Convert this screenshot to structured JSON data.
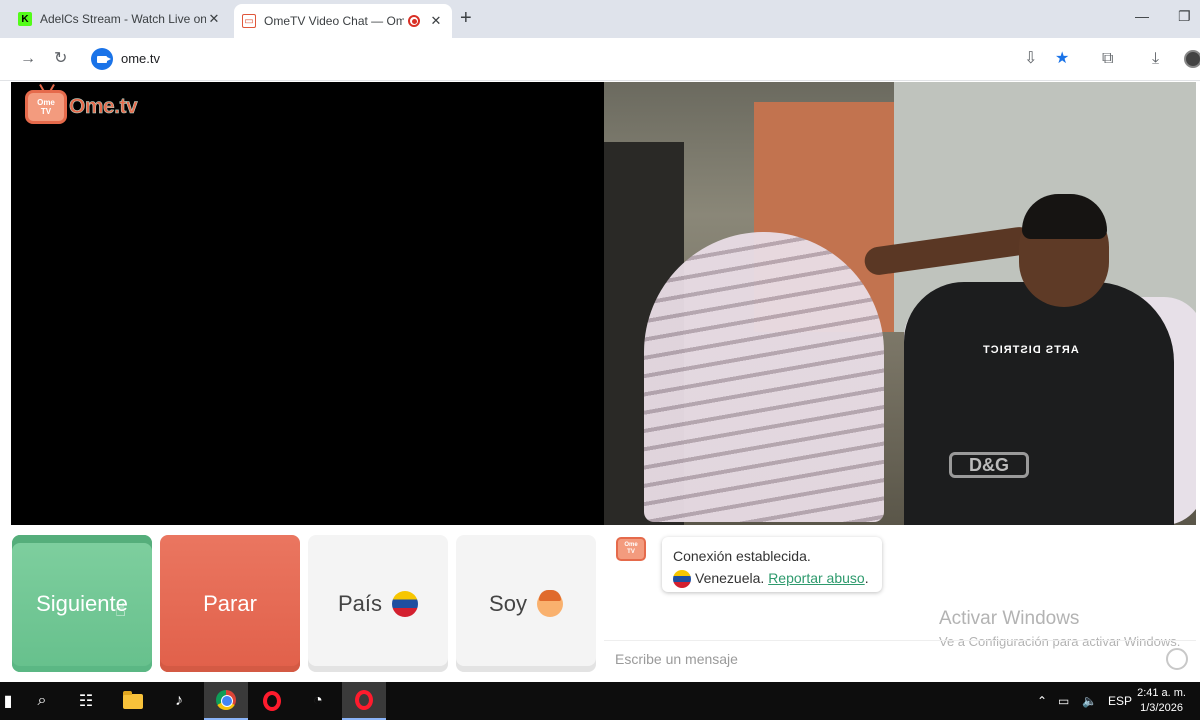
{
  "browser": {
    "tabs": [
      {
        "title": "AdelCs Stream - Watch Live on",
        "favicon": "kick-icon",
        "active": false
      },
      {
        "title": "OmeTV Video Chat — Ome",
        "favicon": "ometv-icon",
        "active": true,
        "recording": true
      }
    ],
    "url": "ome.tv"
  },
  "page": {
    "logo_text": "Ome.tv",
    "logo_badge_top": "Ome",
    "logo_badge_bottom": "TV",
    "remote_shirt_text": "ARTS DISTRICT",
    "remote_belt_text": "D&G",
    "buttons": {
      "next": "Siguiente",
      "stop": "Parar",
      "country": "País",
      "iam": "Soy"
    },
    "chat": {
      "avatar_top": "Ome",
      "avatar_bottom": "TV",
      "status": "Conexión establecida.",
      "country": "Venezuela.",
      "report_link": "Reportar abuso",
      "report_suffix": ".",
      "input_placeholder": "Escribe un mensaje"
    },
    "watermark": {
      "title": "Activar Windows",
      "subtitle": "Ve a Configuración para activar Windows."
    }
  },
  "taskbar": {
    "language": "ESP",
    "time": "2:41 a. m.",
    "date": "1/3/2026"
  },
  "colors": {
    "next": "#6fc795",
    "stop": "#e56a52",
    "accent": "#1a73e8",
    "brand": "#e56a4b"
  }
}
